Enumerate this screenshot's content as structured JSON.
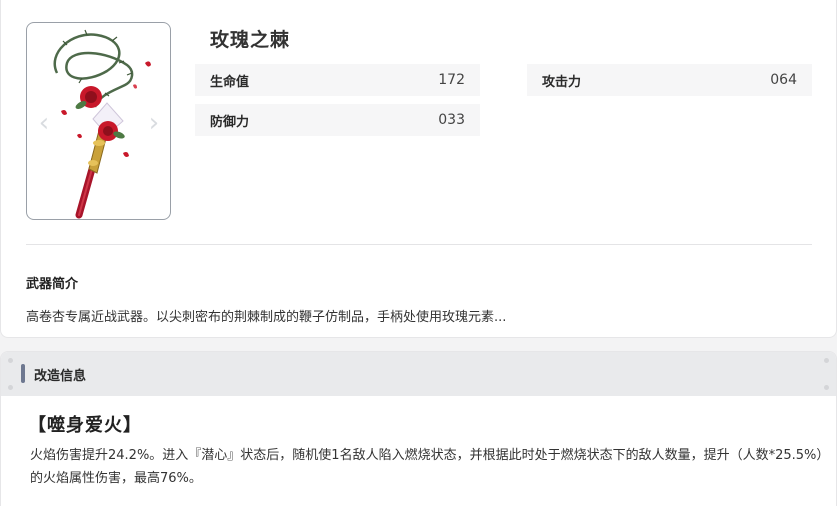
{
  "weapon": {
    "name": "玫瑰之棘",
    "image_icon": "rose-thorn-whip-icon",
    "nav_prev_icon": "‹",
    "nav_next_icon": "›",
    "stats": {
      "hp_label": "生命值",
      "hp_value": "172",
      "atk_label": "攻击力",
      "atk_value": "064",
      "def_label": "防御力",
      "def_value": "033"
    },
    "intro_title": "武器简介",
    "intro_text": "高卷杏专属近战武器。以尖刺密布的荆棘制成的鞭子仿制品，手柄处使用玫瑰元素..."
  },
  "refine": {
    "header": "改造信息",
    "effect_name": "【噬身爱火】",
    "effect_desc": "火焰伤害提升24.2%。进入『潜心』状态后，随机使1名敌人陷入燃烧状态，并根据此时处于燃烧状态下的敌人数量，提升（人数*25.5%）的火焰属性伤害，最高76%。"
  },
  "colors": {
    "accent_bar": "#6e7890",
    "rose_red": "#c8182a",
    "gold": "#c9a13a"
  }
}
